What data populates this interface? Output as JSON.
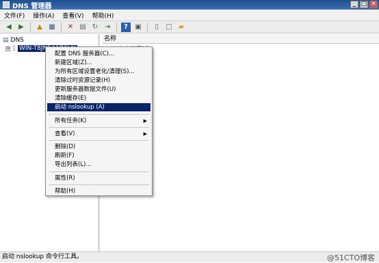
{
  "window": {
    "title": "DNS 管理器",
    "btn_min": "_",
    "btn_max": "□",
    "btn_close": "✕"
  },
  "menubar": {
    "items": [
      "文件(F)",
      "操作(A)",
      "查看(V)",
      "帮助(H)"
    ]
  },
  "toolbar": {
    "icons": [
      "back-icon",
      "forward-icon",
      "up-icon",
      "console-icon",
      "delete-icon",
      "properties-icon",
      "refresh-icon",
      "export-icon",
      "help-icon",
      "view-icon",
      "server-icon",
      "record-icon",
      "folder-icon"
    ]
  },
  "tree": {
    "root": "DNS",
    "server": "WIN-T8JN5A1B0LN",
    "expander": "+"
  },
  "list": {
    "column_name": "名称",
    "first_item": "正向查找区域"
  },
  "context_menu": {
    "group1": [
      "配置 DNS 服务器(C)...",
      "新建区域(Z)...",
      "为所有区域设置老化/清理(S)...",
      "清除过时资源记录(H)",
      "更新服务器数据文件(U)",
      "清除缓存(E)",
      "启动 nslookup (A)"
    ],
    "group2": [
      "所有任务(K)"
    ],
    "group3": [
      "查看(V)"
    ],
    "group4": [
      "删除(D)",
      "刷新(F)",
      "导出列表(L)..."
    ],
    "group5": [
      "属性(R)"
    ],
    "group6": [
      "帮助(H)"
    ],
    "highlighted": "启动 nslookup (A)",
    "submenu_arrow": "▶"
  },
  "statusbar": {
    "text": "启动 nslookup 命令行工具。"
  },
  "watermark": "@51CTO博客"
}
